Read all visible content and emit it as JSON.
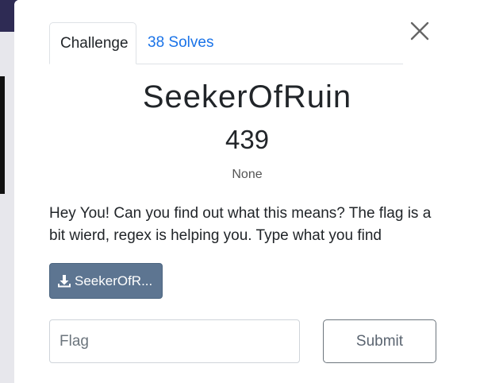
{
  "modal": {
    "tabs": [
      {
        "label": "Challenge",
        "active": true
      },
      {
        "label": "38 Solves",
        "active": false
      }
    ],
    "close_icon": "close-x-icon",
    "title": "SeekerOfRuin",
    "points": "439",
    "category": "None",
    "description": "Hey You! Can you find out what this means? The flag is a bit wierd, regex is helping you. Type what you find",
    "file": {
      "label": "SeekerOfR...",
      "icon": "download-icon"
    },
    "flag_input": {
      "value": "",
      "placeholder": "Flag"
    },
    "submit_label": "Submit"
  },
  "colors": {
    "link": "#1a73e8",
    "file_button": "#5d7591",
    "backdrop": "#2e2b54"
  }
}
